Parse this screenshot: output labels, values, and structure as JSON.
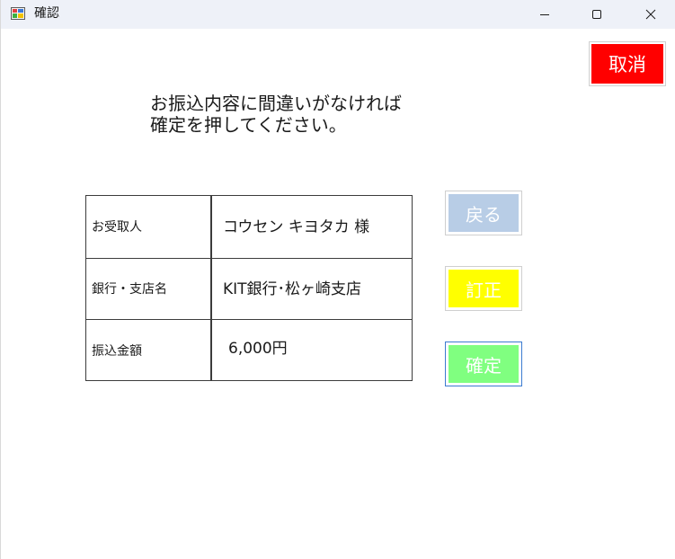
{
  "window": {
    "title": "確認",
    "icon": "app-form-icon"
  },
  "titlebar_buttons": {
    "minimize": "minimize-icon",
    "maximize": "maximize-icon",
    "close": "close-icon"
  },
  "message": {
    "line1": "お振込内容に間違いがなければ",
    "line2": "確定を押してください。"
  },
  "cancel_button": {
    "label": "取消",
    "color": "#ff0000"
  },
  "transfer_details": [
    {
      "label": "お受取人",
      "value": "コウセン キヨタカ 様"
    },
    {
      "label": "銀行・支店名",
      "value": "KIT銀行･松ヶ崎支店"
    },
    {
      "label": "振込金額",
      "value": "6,000円"
    }
  ],
  "actions": {
    "back": {
      "label": "戻る",
      "color": "#b8cde6"
    },
    "correct": {
      "label": "訂正",
      "color": "#ffff00"
    },
    "confirm": {
      "label": "確定",
      "color": "#80ff80"
    }
  }
}
